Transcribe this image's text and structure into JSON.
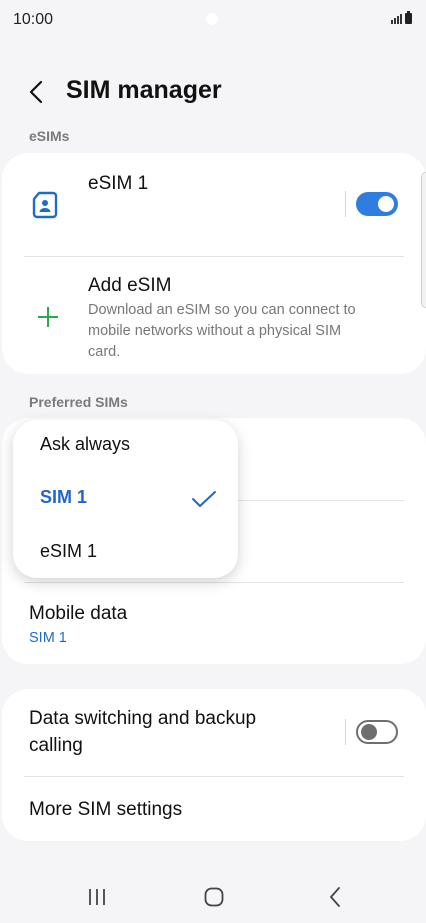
{
  "status_bar": {
    "time": "10:00"
  },
  "header": {
    "title": "SIM manager"
  },
  "esims": {
    "section_label": "eSIMs",
    "esim1": {
      "name": "eSIM 1",
      "enabled": true
    },
    "add": {
      "title": "Add eSIM",
      "description_line1": "Download an eSIM so you can connect to",
      "description_line2": "mobile networks without a physical SIM",
      "description_line3": "card."
    }
  },
  "preferred": {
    "section_label": "Preferred SIMs",
    "mobile_data": {
      "title": "Mobile data",
      "value": "SIM 1"
    }
  },
  "dropdown": {
    "options": [
      "Ask always",
      "SIM 1",
      "eSIM 1"
    ],
    "selected": "SIM 1"
  },
  "other": {
    "data_switching_line1": "Data switching and backup",
    "data_switching_line2": "calling",
    "data_switching_enabled": false,
    "more_settings": "More SIM settings"
  },
  "icons": {
    "back": "back-arrow-icon",
    "sim_card": "sim-card-icon",
    "add": "plus-icon",
    "check": "checkmark-icon",
    "nav_recents": "recents-icon",
    "nav_home": "home-icon",
    "nav_back": "back-icon"
  },
  "colors": {
    "accent": "#2f7de1",
    "add_icon": "#2aa84a",
    "selected_text": "#2266c8"
  }
}
